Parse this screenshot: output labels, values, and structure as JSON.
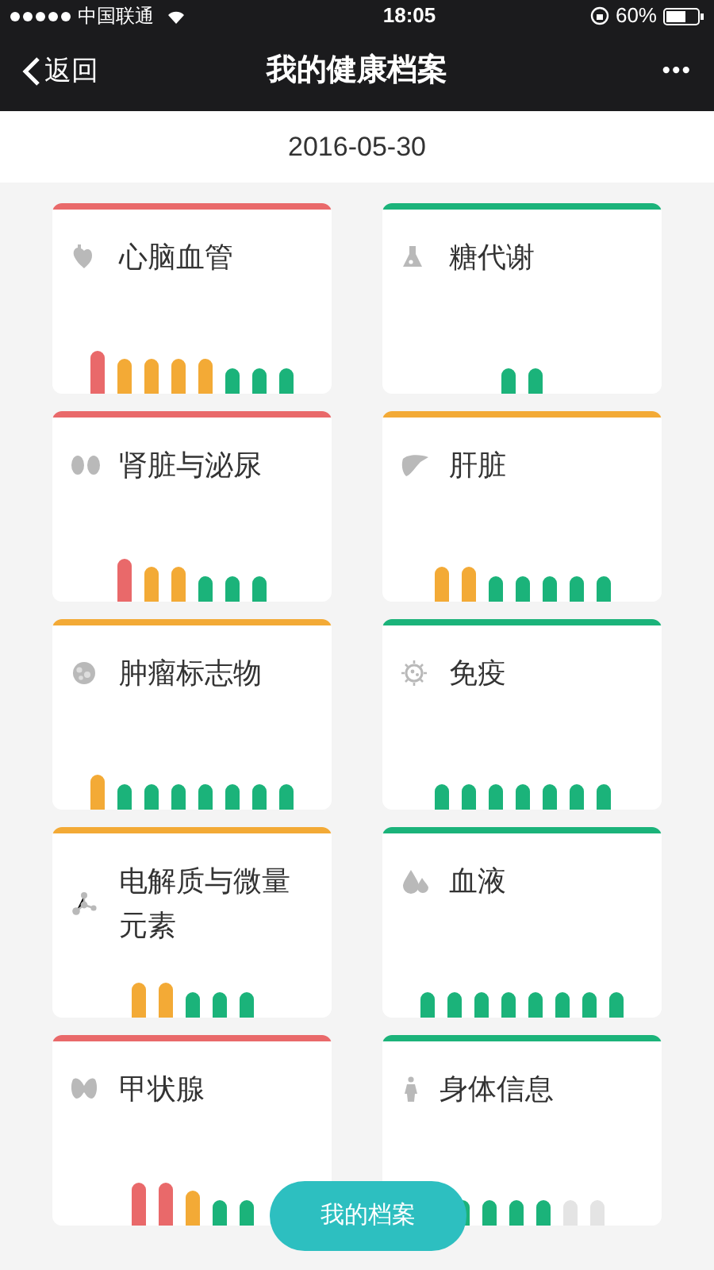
{
  "status_bar": {
    "carrier": "中国联通",
    "time": "18:05",
    "battery": "60%"
  },
  "nav": {
    "back": "返回",
    "title": "我的健康档案",
    "more": "•••"
  },
  "date": "2016-05-30",
  "cards": [
    {
      "title": "心脑血管",
      "color": "#e9696a",
      "bars": [
        {
          "color": "#e9696a"
        },
        {
          "color": "#f3aa36"
        },
        {
          "color": "#f3aa36"
        },
        {
          "color": "#f3aa36"
        },
        {
          "color": "#f3aa36"
        },
        {
          "color": "#1bb37a"
        },
        {
          "color": "#1bb37a"
        },
        {
          "color": "#1bb37a"
        }
      ]
    },
    {
      "title": "糖代谢",
      "color": "#1bb37a",
      "bars": [
        {
          "color": "#1bb37a"
        },
        {
          "color": "#1bb37a"
        }
      ]
    },
    {
      "title": "肾脏与泌尿",
      "color": "#e9696a",
      "bars": [
        {
          "color": "#e9696a"
        },
        {
          "color": "#f3aa36"
        },
        {
          "color": "#f3aa36"
        },
        {
          "color": "#1bb37a"
        },
        {
          "color": "#1bb37a"
        },
        {
          "color": "#1bb37a"
        }
      ]
    },
    {
      "title": "肝脏",
      "color": "#f3aa36",
      "bars": [
        {
          "color": "#f3aa36"
        },
        {
          "color": "#f3aa36"
        },
        {
          "color": "#1bb37a"
        },
        {
          "color": "#1bb37a"
        },
        {
          "color": "#1bb37a"
        },
        {
          "color": "#1bb37a"
        },
        {
          "color": "#1bb37a"
        }
      ]
    },
    {
      "title": "肿瘤标志物",
      "color": "#f3aa36",
      "bars": [
        {
          "color": "#f3aa36"
        },
        {
          "color": "#1bb37a"
        },
        {
          "color": "#1bb37a"
        },
        {
          "color": "#1bb37a"
        },
        {
          "color": "#1bb37a"
        },
        {
          "color": "#1bb37a"
        },
        {
          "color": "#1bb37a"
        },
        {
          "color": "#1bb37a"
        }
      ]
    },
    {
      "title": "免疫",
      "color": "#1bb37a",
      "bars": [
        {
          "color": "#1bb37a"
        },
        {
          "color": "#1bb37a"
        },
        {
          "color": "#1bb37a"
        },
        {
          "color": "#1bb37a"
        },
        {
          "color": "#1bb37a"
        },
        {
          "color": "#1bb37a"
        },
        {
          "color": "#1bb37a"
        }
      ]
    },
    {
      "title": "电解质与微量元素",
      "color": "#f3aa36",
      "bars": [
        {
          "color": "#f3aa36"
        },
        {
          "color": "#f3aa36"
        },
        {
          "color": "#1bb37a"
        },
        {
          "color": "#1bb37a"
        },
        {
          "color": "#1bb37a"
        }
      ]
    },
    {
      "title": "血液",
      "color": "#1bb37a",
      "bars": [
        {
          "color": "#1bb37a"
        },
        {
          "color": "#1bb37a"
        },
        {
          "color": "#1bb37a"
        },
        {
          "color": "#1bb37a"
        },
        {
          "color": "#1bb37a"
        },
        {
          "color": "#1bb37a"
        },
        {
          "color": "#1bb37a"
        },
        {
          "color": "#1bb37a"
        }
      ]
    },
    {
      "title": "甲状腺",
      "color": "#e9696a",
      "bars": [
        {
          "color": "#e9696a"
        },
        {
          "color": "#e9696a"
        },
        {
          "color": "#f3aa36"
        },
        {
          "color": "#1bb37a"
        },
        {
          "color": "#1bb37a"
        }
      ]
    },
    {
      "title": "身体信息",
      "color": "#1bb37a",
      "bars": [
        {
          "color": "#1bb37a"
        },
        {
          "color": "#1bb37a"
        },
        {
          "color": "#1bb37a"
        },
        {
          "color": "#1bb37a"
        },
        {
          "color": "#e4e4e4"
        },
        {
          "color": "#e4e4e4"
        }
      ]
    }
  ],
  "floating_button": "我的档案"
}
